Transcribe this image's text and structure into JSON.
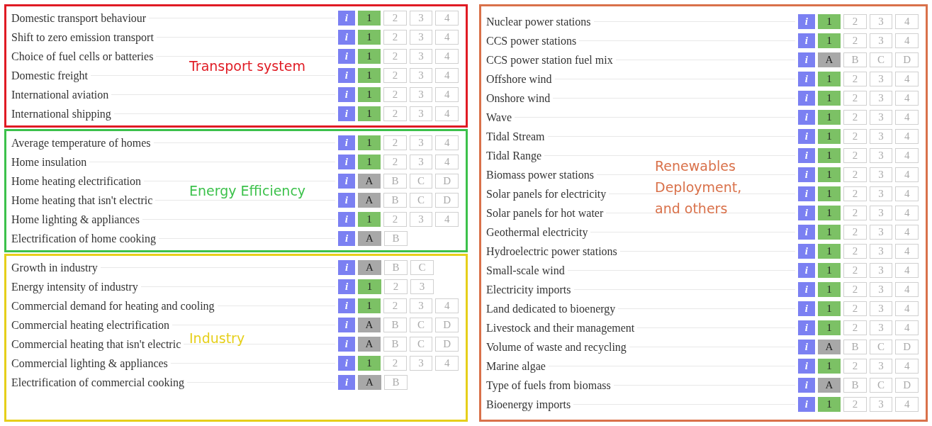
{
  "columns": [
    {
      "groups": [
        {
          "label": "Transport system",
          "color": "#e01b24",
          "rows": [
            {
              "label": "Domestic transport behaviour",
              "info": "i",
              "kind": "number",
              "options": [
                {
                  "label": "1",
                  "selected": true
                },
                {
                  "label": "2",
                  "selected": false
                },
                {
                  "label": "3",
                  "selected": false
                },
                {
                  "label": "4",
                  "selected": false
                }
              ]
            },
            {
              "label": "Shift to zero emission transport",
              "info": "i",
              "kind": "number",
              "options": [
                {
                  "label": "1",
                  "selected": true
                },
                {
                  "label": "2",
                  "selected": false
                },
                {
                  "label": "3",
                  "selected": false
                },
                {
                  "label": "4",
                  "selected": false
                }
              ]
            },
            {
              "label": "Choice of fuel cells or batteries",
              "info": "i",
              "kind": "number",
              "options": [
                {
                  "label": "1",
                  "selected": true
                },
                {
                  "label": "2",
                  "selected": false
                },
                {
                  "label": "3",
                  "selected": false
                },
                {
                  "label": "4",
                  "selected": false
                }
              ]
            },
            {
              "label": "Domestic freight",
              "info": "i",
              "kind": "number",
              "options": [
                {
                  "label": "1",
                  "selected": true
                },
                {
                  "label": "2",
                  "selected": false
                },
                {
                  "label": "3",
                  "selected": false
                },
                {
                  "label": "4",
                  "selected": false
                }
              ]
            },
            {
              "label": "International aviation",
              "info": "i",
              "kind": "number",
              "options": [
                {
                  "label": "1",
                  "selected": true
                },
                {
                  "label": "2",
                  "selected": false
                },
                {
                  "label": "3",
                  "selected": false
                },
                {
                  "label": "4",
                  "selected": false
                }
              ]
            },
            {
              "label": "International shipping",
              "info": "i",
              "kind": "number",
              "options": [
                {
                  "label": "1",
                  "selected": true
                },
                {
                  "label": "2",
                  "selected": false
                },
                {
                  "label": "3",
                  "selected": false
                },
                {
                  "label": "4",
                  "selected": false
                }
              ]
            }
          ]
        },
        {
          "label": "Energy Efficiency",
          "color": "#3cc14b",
          "rows": [
            {
              "label": "Average temperature of homes",
              "info": "i",
              "kind": "number",
              "options": [
                {
                  "label": "1",
                  "selected": true
                },
                {
                  "label": "2",
                  "selected": false
                },
                {
                  "label": "3",
                  "selected": false
                },
                {
                  "label": "4",
                  "selected": false
                }
              ]
            },
            {
              "label": "Home insulation",
              "info": "i",
              "kind": "number",
              "options": [
                {
                  "label": "1",
                  "selected": true
                },
                {
                  "label": "2",
                  "selected": false
                },
                {
                  "label": "3",
                  "selected": false
                },
                {
                  "label": "4",
                  "selected": false
                }
              ]
            },
            {
              "label": "Home heating electrification",
              "info": "i",
              "kind": "letter",
              "options": [
                {
                  "label": "A",
                  "selected": true
                },
                {
                  "label": "B",
                  "selected": false
                },
                {
                  "label": "C",
                  "selected": false
                },
                {
                  "label": "D",
                  "selected": false
                }
              ]
            },
            {
              "label": "Home heating that isn't electric",
              "info": "i",
              "kind": "letter",
              "options": [
                {
                  "label": "A",
                  "selected": true
                },
                {
                  "label": "B",
                  "selected": false
                },
                {
                  "label": "C",
                  "selected": false
                },
                {
                  "label": "D",
                  "selected": false
                }
              ]
            },
            {
              "label": "Home lighting & appliances",
              "info": "i",
              "kind": "number",
              "options": [
                {
                  "label": "1",
                  "selected": true
                },
                {
                  "label": "2",
                  "selected": false
                },
                {
                  "label": "3",
                  "selected": false
                },
                {
                  "label": "4",
                  "selected": false
                }
              ]
            },
            {
              "label": "Electrification of home cooking",
              "info": "i",
              "kind": "letter",
              "options": [
                {
                  "label": "A",
                  "selected": true
                },
                {
                  "label": "B",
                  "selected": false
                }
              ]
            }
          ]
        },
        {
          "label": "Industry",
          "color": "#e6cf1a",
          "rows": [
            {
              "label": "Growth in industry",
              "info": "i",
              "kind": "letter",
              "options": [
                {
                  "label": "A",
                  "selected": true
                },
                {
                  "label": "B",
                  "selected": false
                },
                {
                  "label": "C",
                  "selected": false
                }
              ]
            },
            {
              "label": "Energy intensity of industry",
              "info": "i",
              "kind": "number",
              "options": [
                {
                  "label": "1",
                  "selected": true
                },
                {
                  "label": "2",
                  "selected": false
                },
                {
                  "label": "3",
                  "selected": false
                }
              ]
            },
            {
              "label": "Commercial demand for heating and cooling",
              "info": "i",
              "kind": "number",
              "options": [
                {
                  "label": "1",
                  "selected": true
                },
                {
                  "label": "2",
                  "selected": false
                },
                {
                  "label": "3",
                  "selected": false
                },
                {
                  "label": "4",
                  "selected": false
                }
              ]
            },
            {
              "label": "Commercial heating electrification",
              "info": "i",
              "kind": "letter",
              "options": [
                {
                  "label": "A",
                  "selected": true
                },
                {
                  "label": "B",
                  "selected": false
                },
                {
                  "label": "C",
                  "selected": false
                },
                {
                  "label": "D",
                  "selected": false
                }
              ]
            },
            {
              "label": "Commercial heating that isn't electric",
              "info": "i",
              "kind": "letter",
              "options": [
                {
                  "label": "A",
                  "selected": true
                },
                {
                  "label": "B",
                  "selected": false
                },
                {
                  "label": "C",
                  "selected": false
                },
                {
                  "label": "D",
                  "selected": false
                }
              ]
            },
            {
              "label": "Commercial lighting & appliances",
              "info": "i",
              "kind": "number",
              "options": [
                {
                  "label": "1",
                  "selected": true
                },
                {
                  "label": "2",
                  "selected": false
                },
                {
                  "label": "3",
                  "selected": false
                },
                {
                  "label": "4",
                  "selected": false
                }
              ]
            },
            {
              "label": "Electrification of commercial cooking",
              "info": "i",
              "kind": "letter",
              "options": [
                {
                  "label": "A",
                  "selected": true
                },
                {
                  "label": "B",
                  "selected": false
                }
              ]
            }
          ]
        }
      ]
    },
    {
      "groups": [
        {
          "label": "Renewables\nDeployment,\nand others",
          "color": "#d9714a",
          "rows": [
            {
              "label": "Nuclear power stations",
              "info": "i",
              "kind": "number",
              "options": [
                {
                  "label": "1",
                  "selected": true
                },
                {
                  "label": "2",
                  "selected": false
                },
                {
                  "label": "3",
                  "selected": false
                },
                {
                  "label": "4",
                  "selected": false
                }
              ]
            },
            {
              "label": "CCS power stations",
              "info": "i",
              "kind": "number",
              "options": [
                {
                  "label": "1",
                  "selected": true
                },
                {
                  "label": "2",
                  "selected": false
                },
                {
                  "label": "3",
                  "selected": false
                },
                {
                  "label": "4",
                  "selected": false
                }
              ]
            },
            {
              "label": "CCS power station fuel mix",
              "info": "i",
              "kind": "letter",
              "options": [
                {
                  "label": "A",
                  "selected": true
                },
                {
                  "label": "B",
                  "selected": false
                },
                {
                  "label": "C",
                  "selected": false
                },
                {
                  "label": "D",
                  "selected": false
                }
              ]
            },
            {
              "label": "Offshore wind",
              "info": "i",
              "kind": "number",
              "options": [
                {
                  "label": "1",
                  "selected": true
                },
                {
                  "label": "2",
                  "selected": false
                },
                {
                  "label": "3",
                  "selected": false
                },
                {
                  "label": "4",
                  "selected": false
                }
              ]
            },
            {
              "label": "Onshore wind",
              "info": "i",
              "kind": "number",
              "options": [
                {
                  "label": "1",
                  "selected": true
                },
                {
                  "label": "2",
                  "selected": false
                },
                {
                  "label": "3",
                  "selected": false
                },
                {
                  "label": "4",
                  "selected": false
                }
              ]
            },
            {
              "label": "Wave",
              "info": "i",
              "kind": "number",
              "options": [
                {
                  "label": "1",
                  "selected": true
                },
                {
                  "label": "2",
                  "selected": false
                },
                {
                  "label": "3",
                  "selected": false
                },
                {
                  "label": "4",
                  "selected": false
                }
              ]
            },
            {
              "label": "Tidal Stream",
              "info": "i",
              "kind": "number",
              "options": [
                {
                  "label": "1",
                  "selected": true
                },
                {
                  "label": "2",
                  "selected": false
                },
                {
                  "label": "3",
                  "selected": false
                },
                {
                  "label": "4",
                  "selected": false
                }
              ]
            },
            {
              "label": "Tidal Range",
              "info": "i",
              "kind": "number",
              "options": [
                {
                  "label": "1",
                  "selected": true
                },
                {
                  "label": "2",
                  "selected": false
                },
                {
                  "label": "3",
                  "selected": false
                },
                {
                  "label": "4",
                  "selected": false
                }
              ]
            },
            {
              "label": "Biomass power stations",
              "info": "i",
              "kind": "number",
              "options": [
                {
                  "label": "1",
                  "selected": true
                },
                {
                  "label": "2",
                  "selected": false
                },
                {
                  "label": "3",
                  "selected": false
                },
                {
                  "label": "4",
                  "selected": false
                }
              ]
            },
            {
              "label": "Solar panels for electricity",
              "info": "i",
              "kind": "number",
              "options": [
                {
                  "label": "1",
                  "selected": true
                },
                {
                  "label": "2",
                  "selected": false
                },
                {
                  "label": "3",
                  "selected": false
                },
                {
                  "label": "4",
                  "selected": false
                }
              ]
            },
            {
              "label": "Solar panels for hot water",
              "info": "i",
              "kind": "number",
              "options": [
                {
                  "label": "1",
                  "selected": true
                },
                {
                  "label": "2",
                  "selected": false
                },
                {
                  "label": "3",
                  "selected": false
                },
                {
                  "label": "4",
                  "selected": false
                }
              ]
            },
            {
              "label": "Geothermal electricity",
              "info": "i",
              "kind": "number",
              "options": [
                {
                  "label": "1",
                  "selected": true
                },
                {
                  "label": "2",
                  "selected": false
                },
                {
                  "label": "3",
                  "selected": false
                },
                {
                  "label": "4",
                  "selected": false
                }
              ]
            },
            {
              "label": "Hydroelectric power stations",
              "info": "i",
              "kind": "number",
              "options": [
                {
                  "label": "1",
                  "selected": true
                },
                {
                  "label": "2",
                  "selected": false
                },
                {
                  "label": "3",
                  "selected": false
                },
                {
                  "label": "4",
                  "selected": false
                }
              ]
            },
            {
              "label": "Small-scale wind",
              "info": "i",
              "kind": "number",
              "options": [
                {
                  "label": "1",
                  "selected": true
                },
                {
                  "label": "2",
                  "selected": false
                },
                {
                  "label": "3",
                  "selected": false
                },
                {
                  "label": "4",
                  "selected": false
                }
              ]
            },
            {
              "label": "Electricity imports",
              "info": "i",
              "kind": "number",
              "options": [
                {
                  "label": "1",
                  "selected": true
                },
                {
                  "label": "2",
                  "selected": false
                },
                {
                  "label": "3",
                  "selected": false
                },
                {
                  "label": "4",
                  "selected": false
                }
              ]
            },
            {
              "label": "Land dedicated to bioenergy",
              "info": "i",
              "kind": "number",
              "options": [
                {
                  "label": "1",
                  "selected": true
                },
                {
                  "label": "2",
                  "selected": false
                },
                {
                  "label": "3",
                  "selected": false
                },
                {
                  "label": "4",
                  "selected": false
                }
              ]
            },
            {
              "label": "Livestock and their management",
              "info": "i",
              "kind": "number",
              "options": [
                {
                  "label": "1",
                  "selected": true
                },
                {
                  "label": "2",
                  "selected": false
                },
                {
                  "label": "3",
                  "selected": false
                },
                {
                  "label": "4",
                  "selected": false
                }
              ]
            },
            {
              "label": "Volume of waste and recycling",
              "info": "i",
              "kind": "letter",
              "options": [
                {
                  "label": "A",
                  "selected": true
                },
                {
                  "label": "B",
                  "selected": false
                },
                {
                  "label": "C",
                  "selected": false
                },
                {
                  "label": "D",
                  "selected": false
                }
              ]
            },
            {
              "label": "Marine algae",
              "info": "i",
              "kind": "number",
              "options": [
                {
                  "label": "1",
                  "selected": true
                },
                {
                  "label": "2",
                  "selected": false
                },
                {
                  "label": "3",
                  "selected": false
                },
                {
                  "label": "4",
                  "selected": false
                }
              ]
            },
            {
              "label": "Type of fuels from biomass",
              "info": "i",
              "kind": "letter",
              "options": [
                {
                  "label": "A",
                  "selected": true
                },
                {
                  "label": "B",
                  "selected": false
                },
                {
                  "label": "C",
                  "selected": false
                },
                {
                  "label": "D",
                  "selected": false
                }
              ]
            },
            {
              "label": "Bioenergy imports",
              "info": "i",
              "kind": "number",
              "options": [
                {
                  "label": "1",
                  "selected": true
                },
                {
                  "label": "2",
                  "selected": false
                },
                {
                  "label": "3",
                  "selected": false
                },
                {
                  "label": "4",
                  "selected": false
                }
              ]
            }
          ]
        }
      ]
    }
  ]
}
